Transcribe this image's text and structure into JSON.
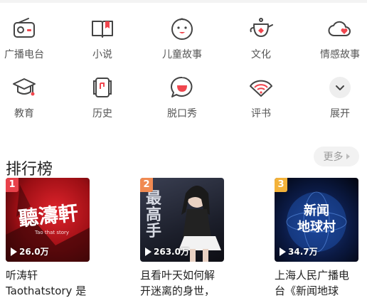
{
  "categories_row1": [
    {
      "label": "广播电台",
      "icon": "radio-icon"
    },
    {
      "label": "小说",
      "icon": "book-icon"
    },
    {
      "label": "儿童故事",
      "icon": "baby-face-icon"
    },
    {
      "label": "文化",
      "icon": "teapot-icon"
    },
    {
      "label": "情感故事",
      "icon": "heart-cloud-icon"
    }
  ],
  "categories_row2": [
    {
      "label": "教育",
      "icon": "graduation-cap-icon"
    },
    {
      "label": "历史",
      "icon": "scroll-icon"
    },
    {
      "label": "脱口秀",
      "icon": "speech-bubble-icon"
    },
    {
      "label": "评书",
      "icon": "folding-fan-icon"
    },
    {
      "label": "展开",
      "icon": "chevron-down-icon"
    }
  ],
  "ranking": {
    "title": "排行榜",
    "more_label": "更多",
    "items": [
      {
        "rank": "1",
        "plays": "26.0万",
        "title": "听涛轩\nTaothatstory 是",
        "cover_text": "聽濤軒",
        "cover_sub": "Tao that story",
        "rank_color": "#e8414a"
      },
      {
        "rank": "2",
        "plays": "263.0万",
        "title": "且看叶天如何解\n开迷离的身世，",
        "cover_text": "最\n高\n手",
        "rank_color": "#f08a52"
      },
      {
        "rank": "3",
        "plays": "34.7万",
        "title": "上海人民广播电\n台《新闻地球",
        "cover_text": "新闻\n地球村",
        "rank_color": "#f3b23a"
      }
    ]
  },
  "colors": {
    "accent": "#f0464e",
    "icon_stroke": "#444444"
  }
}
